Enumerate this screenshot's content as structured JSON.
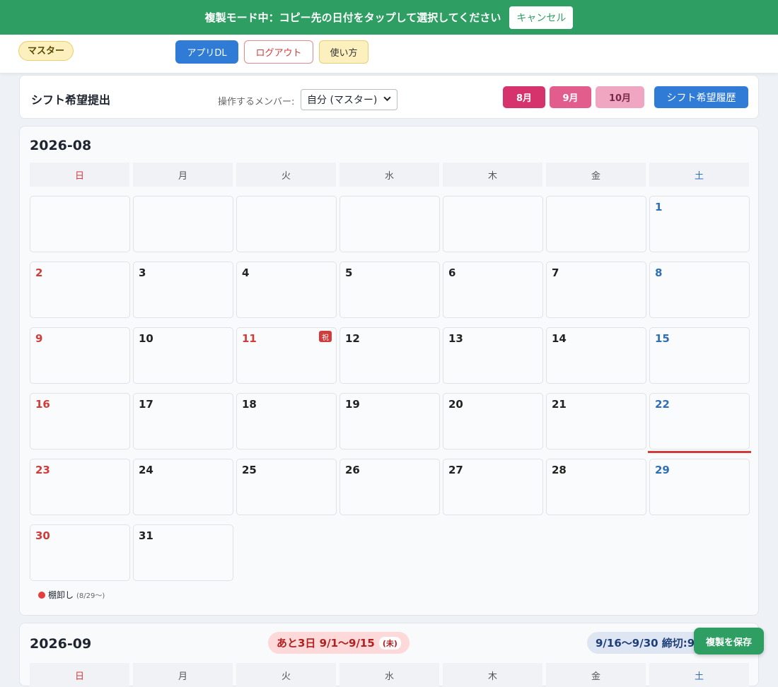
{
  "banner": {
    "text": "複製モード中：コピー先の日付をタップして選択してください",
    "cancel_label": "キャンセル"
  },
  "header": {
    "master_badge": "マスター",
    "app_dl": "アプリDL",
    "logout": "ログアウト",
    "howto": "使い方"
  },
  "toolbar": {
    "title": "シフト希望提出",
    "member_label": "操作するメンバー:",
    "member_value": "自分 (マスター)",
    "months": [
      "8月",
      "9月",
      "10月"
    ],
    "history": "シフト希望履歴"
  },
  "weekdays": [
    "日",
    "月",
    "火",
    "水",
    "木",
    "金",
    "土"
  ],
  "august": {
    "title": "2026-08",
    "first_weekday": 6,
    "days_in_month": 31,
    "holidays": [
      11
    ],
    "holiday_badge": "祝",
    "today": 22,
    "legend_label": "棚卸し",
    "legend_range": "(8/29〜)"
  },
  "september": {
    "title": "2026-09",
    "deadline_main": "あと3日 9/1〜9/15",
    "deadline_sub": "(未)",
    "second_period": "9/16〜9/30 締切:9/10"
  },
  "save_label": "複製を保存"
}
